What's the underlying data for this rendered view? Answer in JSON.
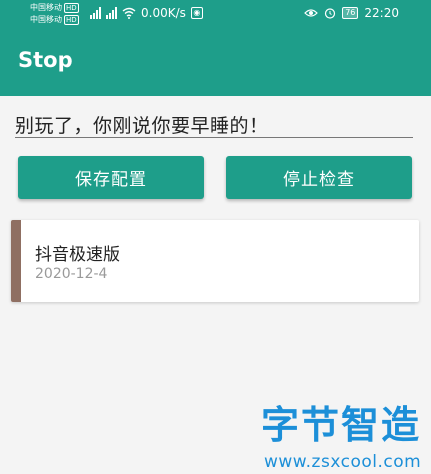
{
  "status_bar": {
    "carrier1": "中国移动",
    "carrier2": "中国移动",
    "hd": "HD",
    "speed": "0.00K/s",
    "battery": "76",
    "time": "22:20"
  },
  "app": {
    "title": "Stop",
    "accent_color": "#1e9e8a"
  },
  "message_input": {
    "value": "别玩了，你刚说你要早睡的！"
  },
  "buttons": {
    "save_label": "保存配置",
    "stop_label": "停止检查"
  },
  "app_list": [
    {
      "name": "抖音极速版",
      "date": "2020-12-4",
      "color": "#8f6f62"
    }
  ],
  "watermark": {
    "title": "字节智造",
    "url": "www.zsxcool.com"
  }
}
